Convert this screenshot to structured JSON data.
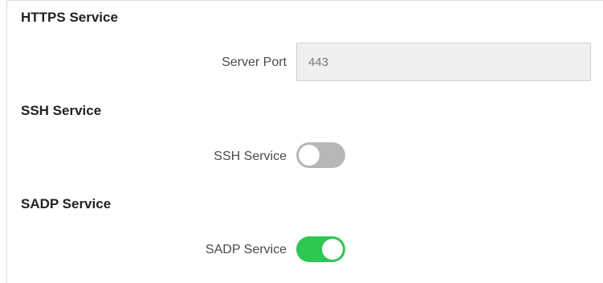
{
  "sections": {
    "https": {
      "title": "HTTPS Service",
      "server_port_label": "Server Port",
      "server_port_value": "443"
    },
    "ssh": {
      "title": "SSH Service",
      "toggle_label": "SSH Service",
      "enabled": false
    },
    "sadp": {
      "title": "SADP Service",
      "toggle_label": "SADP Service",
      "enabled": true
    }
  },
  "colors": {
    "toggle_on": "#2ec751",
    "toggle_off": "#b7b7b7",
    "input_background": "#f0f0f0"
  }
}
